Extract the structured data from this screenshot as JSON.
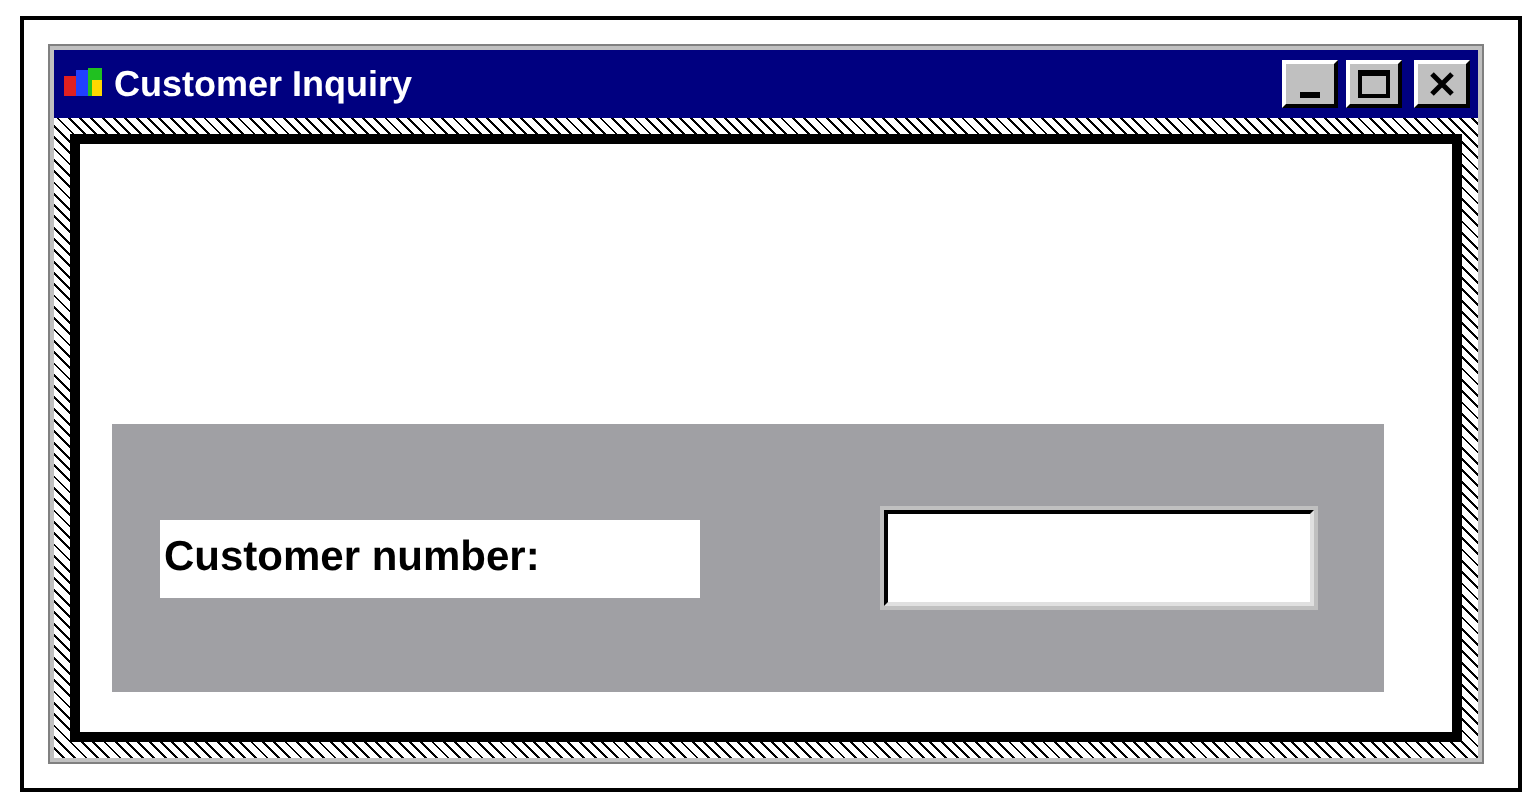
{
  "window": {
    "title": "Customer Inquiry"
  },
  "form": {
    "label": "Customer number:"
  }
}
